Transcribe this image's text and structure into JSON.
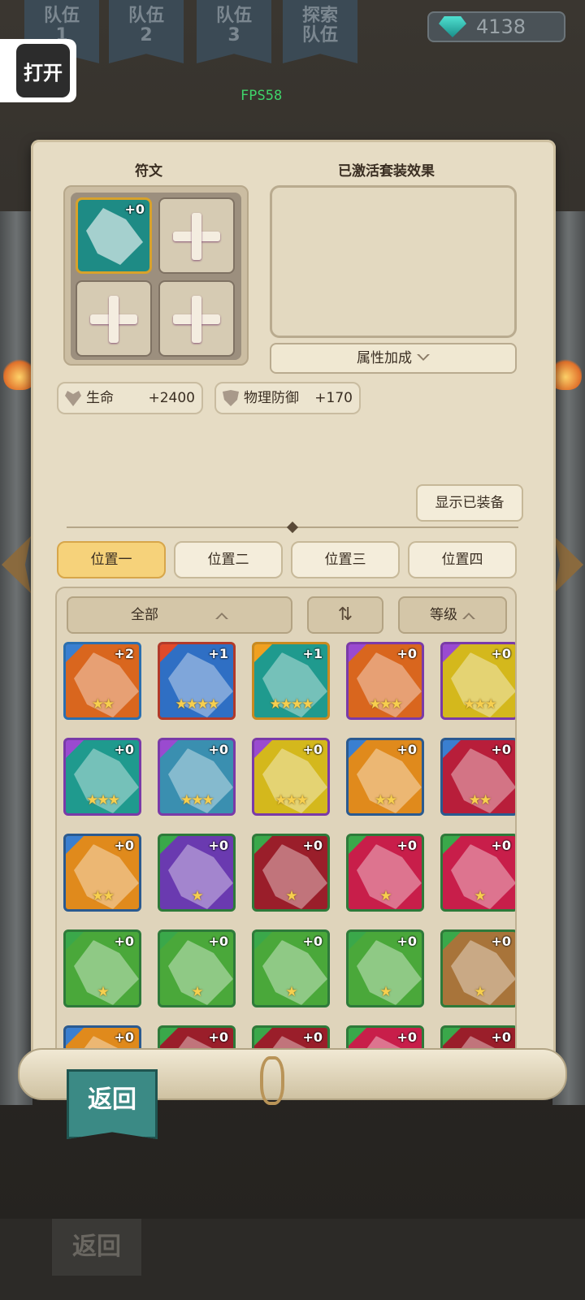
{
  "header": {
    "team_tabs": [
      {
        "l1": "队伍",
        "l2": "1"
      },
      {
        "l1": "队伍",
        "l2": "2"
      },
      {
        "l1": "队伍",
        "l2": "3"
      },
      {
        "l1": "探索",
        "l2": "队伍"
      }
    ],
    "gems": "4138",
    "open_label": "打开",
    "fps": "FPS58"
  },
  "panel": {
    "rune_title": "符文",
    "set_title": "已激活套装效果",
    "equipped_slot_level": "+0",
    "attr_label": "属性加成",
    "stats": [
      {
        "name": "生命",
        "value": "+2400",
        "icon": "heart-icon"
      },
      {
        "name": "物理防御",
        "value": "+170",
        "icon": "shield-icon"
      }
    ],
    "show_equipped_label": "显示已装备",
    "positions": [
      "位置一",
      "位置二",
      "位置三",
      "位置四"
    ],
    "active_position": 0,
    "filter_all": "全部",
    "filter_level": "等级"
  },
  "inventory": [
    {
      "lvl": "+2",
      "stars": "★★",
      "bg": "#d9661e",
      "border": "#2a6fb0",
      "corner": "#3a7fd0"
    },
    {
      "lvl": "+1",
      "stars": "★★★★",
      "bg": "#2f6fc4",
      "border": "#b23a2a",
      "corner": "#e04a2a"
    },
    {
      "lvl": "+1",
      "stars": "★★★★",
      "bg": "#1f9a8e",
      "border": "#c98a20",
      "corner": "#f0a020"
    },
    {
      "lvl": "+0",
      "stars": "★★★",
      "bg": "#d9661e",
      "border": "#7a3aa8",
      "corner": "#9a4ad0"
    },
    {
      "lvl": "+0",
      "stars": "★★★",
      "bg": "#d4b81c",
      "border": "#7a3aa8",
      "corner": "#9a4ad0"
    },
    {
      "lvl": "+0",
      "stars": "★★★",
      "bg": "#1f9a8e",
      "border": "#7a3aa8",
      "corner": "#9a4ad0"
    },
    {
      "lvl": "+0",
      "stars": "★★★",
      "bg": "#3a8fb0",
      "border": "#7a3aa8",
      "corner": "#9a4ad0"
    },
    {
      "lvl": "+0",
      "stars": "★★★",
      "bg": "#d4b81c",
      "border": "#7a3aa8",
      "corner": "#9a4ad0"
    },
    {
      "lvl": "+0",
      "stars": "★★",
      "bg": "#e08a1c",
      "border": "#2a5a90",
      "corner": "#3a7fd0"
    },
    {
      "lvl": "+0",
      "stars": "★★",
      "bg": "#b81e3a",
      "border": "#2a5a90",
      "corner": "#3a7fd0"
    },
    {
      "lvl": "+0",
      "stars": "★★",
      "bg": "#e08a1c",
      "border": "#2a5a90",
      "corner": "#3a7fd0"
    },
    {
      "lvl": "+0",
      "stars": "★",
      "bg": "#6a3ab0",
      "border": "#2e7a3a",
      "corner": "#3aa84a"
    },
    {
      "lvl": "+0",
      "stars": "★",
      "bg": "#9a1e2a",
      "border": "#2e7a3a",
      "corner": "#3aa84a"
    },
    {
      "lvl": "+0",
      "stars": "★",
      "bg": "#c81e4a",
      "border": "#2e7a3a",
      "corner": "#3aa84a"
    },
    {
      "lvl": "+0",
      "stars": "★",
      "bg": "#c81e4a",
      "border": "#2e7a3a",
      "corner": "#3aa84a"
    },
    {
      "lvl": "+0",
      "stars": "★",
      "bg": "#4aa83a",
      "border": "#2e7a3a",
      "corner": "#3aa84a"
    },
    {
      "lvl": "+0",
      "stars": "★",
      "bg": "#4aa83a",
      "border": "#2e7a3a",
      "corner": "#3aa84a"
    },
    {
      "lvl": "+0",
      "stars": "★",
      "bg": "#4aa83a",
      "border": "#2e7a3a",
      "corner": "#3aa84a"
    },
    {
      "lvl": "+0",
      "stars": "★",
      "bg": "#4aa83a",
      "border": "#2e7a3a",
      "corner": "#3aa84a"
    },
    {
      "lvl": "+0",
      "stars": "★",
      "bg": "#a8743a",
      "border": "#2e7a3a",
      "corner": "#3aa84a"
    },
    {
      "lvl": "+0",
      "stars": "",
      "bg": "#e08a1c",
      "border": "#2a5a90",
      "corner": "#3a7fd0"
    },
    {
      "lvl": "+0",
      "stars": "",
      "bg": "#9a1e2a",
      "border": "#2e7a3a",
      "corner": "#3aa84a"
    },
    {
      "lvl": "+0",
      "stars": "",
      "bg": "#9a1e2a",
      "border": "#2e7a3a",
      "corner": "#3aa84a"
    },
    {
      "lvl": "+0",
      "stars": "",
      "bg": "#c81e4a",
      "border": "#2e7a3a",
      "corner": "#3aa84a"
    },
    {
      "lvl": "+0",
      "stars": "",
      "bg": "#9a1e2a",
      "border": "#2e7a3a",
      "corner": "#3aa84a"
    }
  ],
  "footer": {
    "back_label": "返回",
    "back_ghost_label": "返回"
  }
}
